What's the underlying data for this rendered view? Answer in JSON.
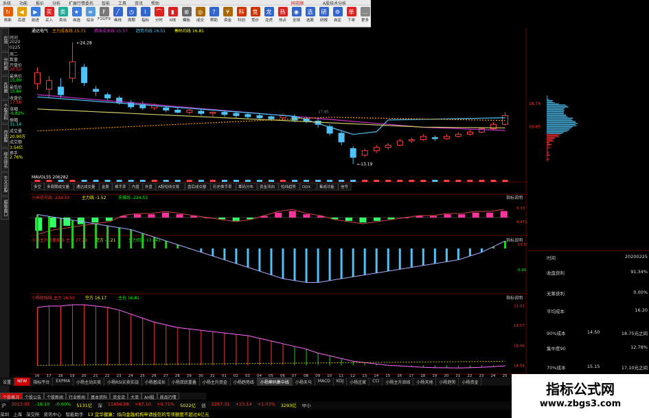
{
  "app": {
    "title_center": "同花顺",
    "title_right": "A股技术分析",
    "menu": [
      "系统",
      "功能",
      "报价",
      "分析",
      "扩展行情",
      "委托",
      "智能",
      "工具",
      "资讯",
      "帮助"
    ],
    "toolbar": [
      {
        "label": "刷新",
        "color": "#e55b00",
        "icon": "↻"
      },
      {
        "label": "后退",
        "color": "#e5a000",
        "icon": "◀"
      },
      {
        "label": "前进",
        "color": "#3a7be0",
        "icon": "▶"
      },
      {
        "label": "买入",
        "color": "#d22",
        "icon": "买"
      },
      {
        "label": "卖出",
        "color": "#2a9",
        "icon": "卖"
      },
      {
        "label": "自选",
        "color": "#3a7be0",
        "icon": "★"
      },
      {
        "label": "综合",
        "color": "#5599dd",
        "icon": "≡"
      },
      {
        "label": "F10/F9",
        "color": "#777",
        "icon": "F"
      },
      {
        "label": "画线",
        "color": "#3366cc",
        "icon": "╱"
      },
      {
        "label": "周期",
        "color": "#3366cc",
        "icon": "◷"
      },
      {
        "label": "指标",
        "color": "#3366cc",
        "icon": "⌇"
      },
      {
        "label": "分时",
        "color": "#d22",
        "icon": "⌒"
      },
      {
        "label": "K线",
        "color": "#d22",
        "icon": "▮"
      },
      {
        "label": "模板",
        "color": "#666",
        "icon": "⊞"
      },
      {
        "label": "成交",
        "color": "#aa6600",
        "icon": "◎"
      },
      {
        "label": "帮助",
        "color": "#3366cc",
        "icon": "?"
      },
      {
        "label": "资金",
        "color": "#aa6600",
        "icon": "¥"
      },
      {
        "label": "科创",
        "color": "#cc3300",
        "icon": "科"
      },
      {
        "label": "竞价",
        "color": "#cc3300",
        "icon": "竞"
      },
      {
        "label": "龙虎",
        "color": "#3366cc",
        "icon": "龙"
      },
      {
        "label": "热点",
        "color": "#d22",
        "icon": "热"
      },
      {
        "label": "全球",
        "color": "#3366cc",
        "icon": "◉"
      },
      {
        "label": "选股",
        "color": "#3366cc",
        "icon": "选"
      },
      {
        "label": "研报",
        "color": "#3366cc",
        "icon": "研"
      },
      {
        "label": "自定",
        "color": "#3366cc",
        "icon": "⚙"
      },
      {
        "label": "下单",
        "color": "#d22",
        "icon": "单"
      },
      {
        "label": "更多",
        "color": "#888",
        "icon": "…"
      }
    ]
  },
  "left_tabs": [
    "应用",
    "分时图",
    "K线图",
    "个股资料",
    "自选股",
    "综合排名",
    "牛叉诊股",
    "超级盘口"
  ],
  "quote": {
    "labels": [
      "时间",
      "2020",
      "0225",
      "周二",
      "数量",
      "开盘价",
      "最高价",
      "最低价",
      "收盘价",
      "涨幅",
      "振幅",
      "成交量",
      "成交额",
      "换手"
    ],
    "values": [
      "20.53",
      "15.00",
      "15.84",
      "17.58",
      "-6.82%",
      "31.14",
      "20.90万",
      "3.54亿",
      "2.76%"
    ]
  },
  "main_chart": {
    "stock_name": "通达电气",
    "legend": [
      {
        "text": "主力成本线 15.71",
        "color": "#ff9900"
      },
      {
        "text": "精准成本线 15.57",
        "color": "#cc33cc"
      },
      {
        "text": "趋势均线 16.51",
        "color": "#4fc3f7"
      },
      {
        "text": "筹码均线 16.81",
        "color": "#ffff00"
      }
    ],
    "high_label": "24.28",
    "low_label": "13.19",
    "mid_label": "17.85",
    "price_axis": [
      "18.74",
      "16.65"
    ],
    "volume_legend": "MAVOL55 206282",
    "indicator_tabs": [
      "多空",
      "多周期成交量",
      "通达成交量",
      "金股",
      "换手率",
      "内盘",
      "外盘",
      "A股短线交易",
      "盘后成交额",
      "历史换手率",
      "筹码分布",
      "资金流向",
      "短线趋势",
      "DDX",
      "集成功能",
      "信号"
    ]
  },
  "panel1": {
    "legend": "小米信号线 -224.33",
    "legend2": "主力线 -1.52",
    "legend3": "支撑线 -224.53",
    "values": [
      -8,
      -6,
      -5,
      -4,
      -3,
      -2,
      1,
      2,
      2,
      3,
      2,
      1,
      0,
      -1,
      -2,
      -1,
      1,
      3,
      4,
      2,
      1,
      -1,
      -2,
      -3,
      -2,
      -1,
      0,
      1,
      1,
      2,
      2,
      3,
      3,
      4
    ],
    "axis": [
      "5.33",
      "0.471",
      "-10.53"
    ],
    "btn": "指标说明"
  },
  "panel2": {
    "legend": "小杨主升浪量能线 主力 27.29",
    "legend2": "空方 -7.21",
    "legend3": "主力回升 17.041",
    "values": [
      9,
      8.5,
      8,
      7.5,
      7,
      6.5,
      6,
      5.5,
      5,
      4,
      3,
      2,
      1,
      0,
      -1,
      -2,
      -3,
      -4,
      -5,
      -6,
      -7,
      -8,
      -8.5,
      -9,
      -9,
      -8.5,
      -8,
      -7.5,
      -7,
      -6.5,
      -6,
      -5.5,
      -5,
      -4.5,
      -4,
      -3.5,
      -3,
      -2,
      -1,
      0.5,
      2
    ],
    "axis": [
      "-5.95"
    ],
    "btn": "指标说明"
  },
  "panel3": {
    "legend": "小杨短线线 主力 16.50",
    "legend2": "空方 16.17",
    "legend3": "主仓 16.81",
    "values": [
      20.9,
      21.0,
      21.0,
      21.1,
      21.1,
      21.0,
      20.9,
      20.7,
      20.4,
      20.1,
      19.8,
      19.6,
      19.4,
      19.3,
      19.2,
      19.1,
      19.0,
      18.9,
      18.8,
      18.6,
      18.4,
      18.2,
      18.0,
      17.8,
      17.5,
      17.3,
      17.1,
      16.9,
      16.8,
      16.7,
      16.6,
      16.55,
      16.5,
      16.45,
      16.42,
      16.41,
      16.4,
      16.42,
      16.45,
      16.5,
      16.55
    ],
    "axis": [
      "21.03",
      "19.57",
      "18.06",
      "16.59"
    ],
    "btn": "指标说明"
  },
  "x_axis": [
    "16",
    "17",
    "18",
    "19",
    "20",
    "21",
    "22",
    "23",
    "24",
    "25",
    "26",
    "27",
    "28",
    "29",
    "30",
    "31",
    "01",
    "02",
    "03",
    "04",
    "05",
    "06",
    "07",
    "08",
    "09",
    "10",
    "11",
    "12",
    "13",
    "14",
    "15",
    "16",
    "17",
    "18",
    "19",
    "20",
    "21",
    "22",
    "23",
    "24",
    "25"
  ],
  "right_panel": {
    "rows": [
      {
        "k": "时间",
        "v": "20200225"
      },
      {
        "k": "收盘获利",
        "v": "91.34%"
      },
      {
        "k": "无筹获利",
        "v": "0.00%"
      },
      {
        "k": "平均成本",
        "v": "16.20"
      },
      {
        "k": "90%成本",
        "v": "14.50",
        "v2": "18.75元之间"
      },
      {
        "k": "集中度90",
        "v": "12.78%"
      },
      {
        "k": "70%成本",
        "v": "15.15",
        "v2": "17.10元之间"
      }
    ]
  },
  "tabbar": [
    "设置",
    "NEW",
    "指标平台",
    "EXPMA",
    "小杨主动买卖",
    "小杨RSI买卖实战",
    "小杨基成长",
    "小杨双底重叠",
    "小杨主升资金",
    "小杨趋势线",
    "小杨筹码集中线",
    "小杨天马",
    "MACD",
    "KDJ",
    "小杨庄家",
    "CCI",
    "小杨主升浪线",
    "小杨天地",
    "小杨趋势",
    "小杨资金"
  ],
  "subtabs": [
    "个股概况",
    "个股公告",
    "个股新闻",
    "行业新闻",
    "基本资料",
    "资金流",
    "大单",
    "AH股",
    "商品行情"
  ],
  "ticker": [
    {
      "text": "沪",
      "color": "#ccc"
    },
    {
      "text": "3013.05",
      "color": "#f33"
    },
    {
      "text": "-18.10",
      "color": "#0f0"
    },
    {
      "text": "-0.60%",
      "color": "#0f0"
    },
    {
      "text": "5131亿",
      "color": "#ff0"
    },
    {
      "text": "深",
      "color": "#ccc"
    },
    {
      "text": "11856.08",
      "color": "#f33"
    },
    {
      "text": "+87.10",
      "color": "#f33"
    },
    {
      "text": "+0.71%",
      "color": "#f33"
    },
    {
      "text": "5022亿",
      "color": "#ff0"
    },
    {
      "text": "创",
      "color": "#ccc"
    },
    {
      "text": "2287.31",
      "color": "#f33"
    },
    {
      "text": "+23.14",
      "color": "#f33"
    },
    {
      "text": "+1.03%",
      "color": "#f33"
    },
    {
      "text": "3293亿",
      "color": "#ff0"
    },
    {
      "text": "中小",
      "color": "#ccc"
    }
  ],
  "news": [
    {
      "text": "深圳",
      "color": "#ccc"
    },
    {
      "text": "上海",
      "color": "#ccc"
    },
    {
      "text": "深交所",
      "color": "#ccc"
    },
    {
      "text": "资讯中心",
      "color": "#ccc"
    },
    {
      "text": "智能助手",
      "color": "#ccc"
    },
    {
      "text": "13 宜华健康：拟向金融机构申请授信的专项额度不超过6亿元",
      "color": "#ff0"
    }
  ],
  "watermark": {
    "title": "指标公式网",
    "url": "www.zbgs3.com"
  }
}
